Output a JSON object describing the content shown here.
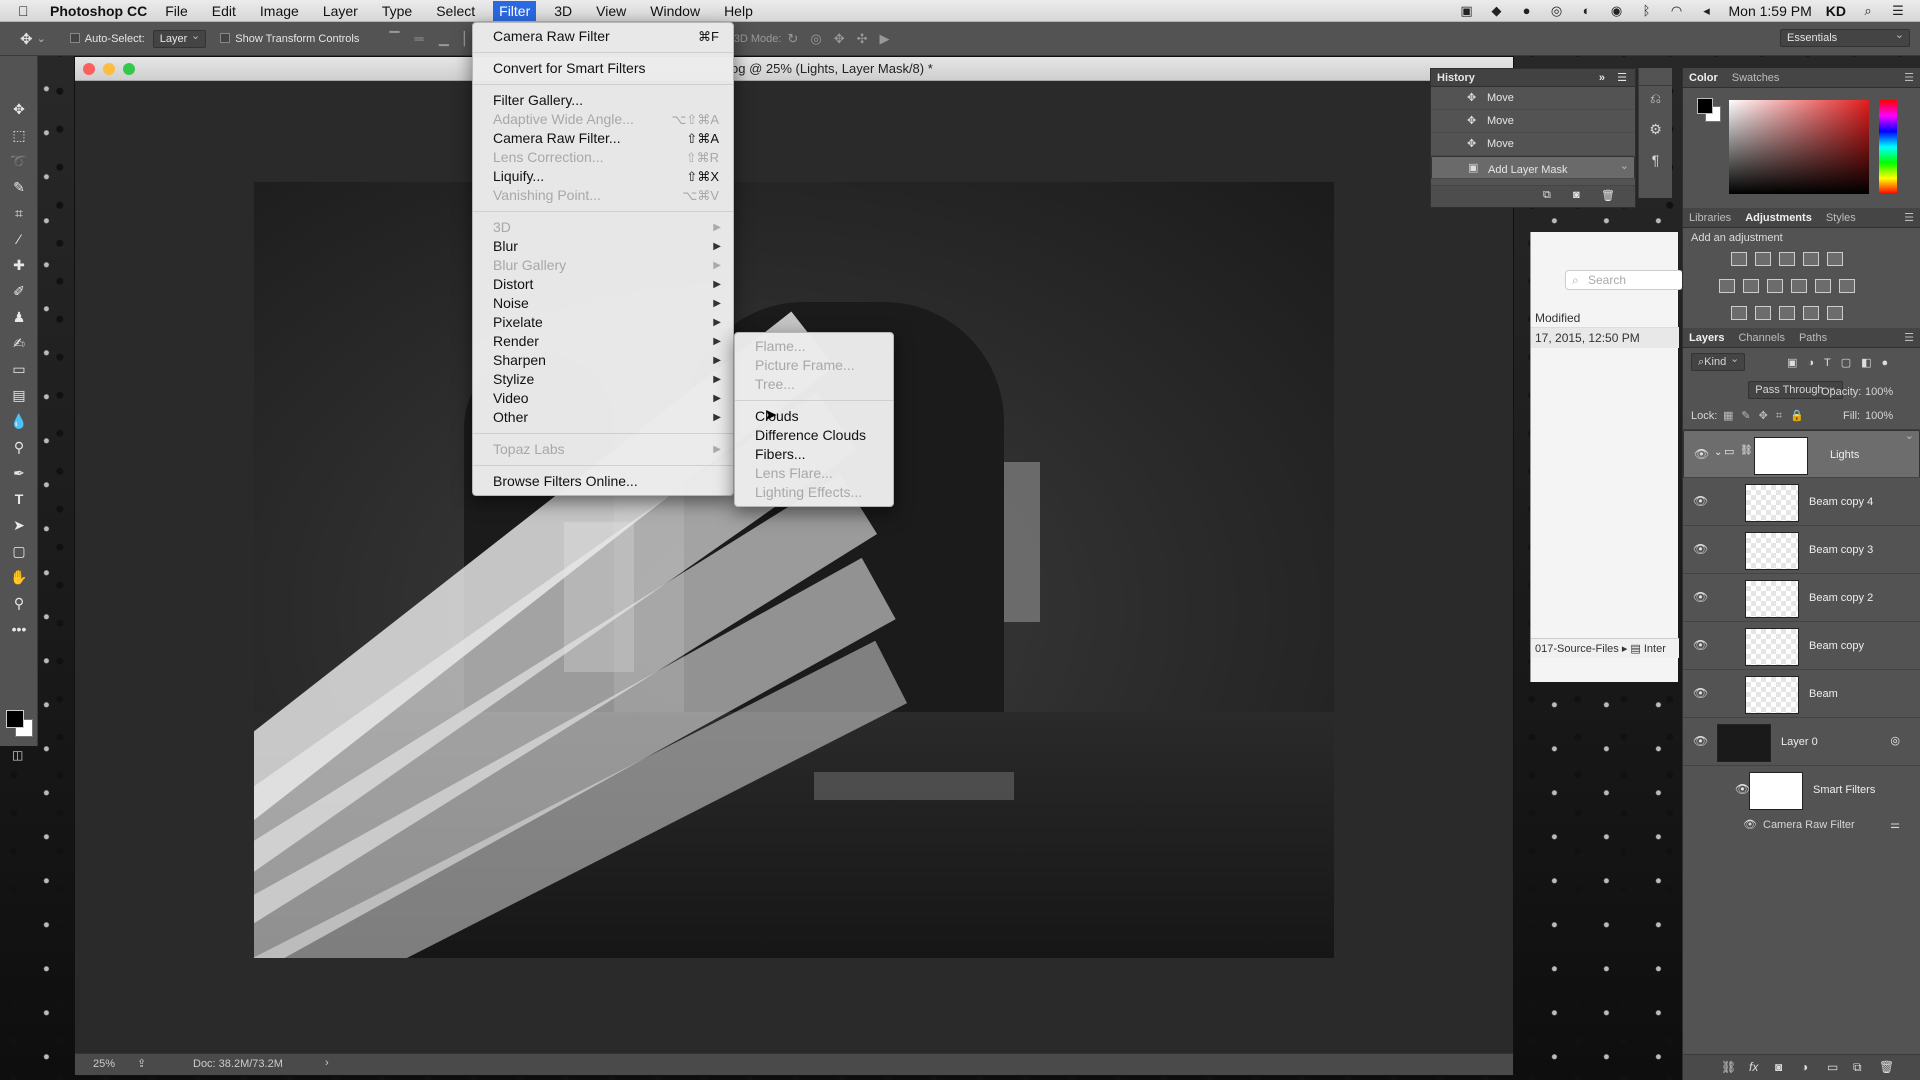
{
  "menubar": {
    "app_name": "Photoshop CC",
    "items": [
      "File",
      "Edit",
      "Image",
      "Layer",
      "Type",
      "Select",
      "Filter",
      "3D",
      "View",
      "Window",
      "Help"
    ],
    "active_item": "Filter",
    "clock": "Mon 1:59 PM",
    "user": "KD"
  },
  "options_bar": {
    "auto_select_label": "Auto-Select:",
    "auto_select_value": "Layer",
    "show_transform_label": "Show Transform Controls",
    "mode_3d_label": "3D Mode:",
    "workspace": "Essentials"
  },
  "document": {
    "title": "og @ 25% (Lights, Layer Mask/8) *",
    "zoom": "25%",
    "doc_size": "Doc: 38.2M/73.2M"
  },
  "filter_menu": {
    "items": [
      {
        "label": "Camera Raw Filter",
        "shortcut": "⌘F",
        "disabled": false,
        "submenu": false
      },
      {
        "sep": true
      },
      {
        "label": "Convert for Smart Filters",
        "shortcut": "",
        "disabled": false,
        "submenu": false
      },
      {
        "sep": true
      },
      {
        "label": "Filter Gallery...",
        "shortcut": "",
        "disabled": false,
        "submenu": false
      },
      {
        "label": "Adaptive Wide Angle...",
        "shortcut": "⌥⇧⌘A",
        "disabled": true,
        "submenu": false
      },
      {
        "label": "Camera Raw Filter...",
        "shortcut": "⇧⌘A",
        "disabled": false,
        "submenu": false
      },
      {
        "label": "Lens Correction...",
        "shortcut": "⇧⌘R",
        "disabled": true,
        "submenu": false
      },
      {
        "label": "Liquify...",
        "shortcut": "⇧⌘X",
        "disabled": false,
        "submenu": false
      },
      {
        "label": "Vanishing Point...",
        "shortcut": "⌥⌘V",
        "disabled": true,
        "submenu": false
      },
      {
        "sep": true
      },
      {
        "label": "3D",
        "shortcut": "",
        "disabled": true,
        "submenu": true
      },
      {
        "label": "Blur",
        "shortcut": "",
        "disabled": false,
        "submenu": true
      },
      {
        "label": "Blur Gallery",
        "shortcut": "",
        "disabled": true,
        "submenu": true
      },
      {
        "label": "Distort",
        "shortcut": "",
        "disabled": false,
        "submenu": true
      },
      {
        "label": "Noise",
        "shortcut": "",
        "disabled": false,
        "submenu": true
      },
      {
        "label": "Pixelate",
        "shortcut": "",
        "disabled": false,
        "submenu": true
      },
      {
        "label": "Render",
        "shortcut": "",
        "disabled": false,
        "submenu": true
      },
      {
        "label": "Sharpen",
        "shortcut": "",
        "disabled": false,
        "submenu": true
      },
      {
        "label": "Stylize",
        "shortcut": "",
        "disabled": false,
        "submenu": true
      },
      {
        "label": "Video",
        "shortcut": "",
        "disabled": false,
        "submenu": true
      },
      {
        "label": "Other",
        "shortcut": "",
        "disabled": false,
        "submenu": true
      },
      {
        "sep": true
      },
      {
        "label": "Topaz Labs",
        "shortcut": "",
        "disabled": true,
        "submenu": true
      },
      {
        "sep": true
      },
      {
        "label": "Browse Filters Online...",
        "shortcut": "",
        "disabled": false,
        "submenu": false
      }
    ]
  },
  "render_submenu": {
    "items": [
      {
        "label": "Flame...",
        "disabled": true
      },
      {
        "label": "Picture Frame...",
        "disabled": true
      },
      {
        "label": "Tree...",
        "disabled": true
      },
      {
        "sep": true
      },
      {
        "label": "Clouds",
        "disabled": false
      },
      {
        "label": "Difference Clouds",
        "disabled": false
      },
      {
        "label": "Fibers...",
        "disabled": false
      },
      {
        "label": "Lens Flare...",
        "disabled": true
      },
      {
        "label": "Lighting Effects...",
        "disabled": true
      }
    ]
  },
  "history_panel": {
    "title": "History",
    "rows": [
      {
        "label": "Move",
        "selected": false
      },
      {
        "label": "Move",
        "selected": false
      },
      {
        "label": "Move",
        "selected": false
      },
      {
        "label": "Add Layer Mask",
        "selected": true
      }
    ]
  },
  "finder_fragment": {
    "search_placeholder": "Search",
    "column_modified": "Modified",
    "date": "17, 2015, 12:50 PM",
    "path_a": "017-Source-Files",
    "path_b": "Inter"
  },
  "color_panel": {
    "tabs": [
      "Color",
      "Swatches"
    ],
    "active": "Color"
  },
  "adjustments_panel": {
    "tabs": [
      "Libraries",
      "Adjustments",
      "Styles"
    ],
    "active": "Adjustments",
    "heading": "Add an adjustment"
  },
  "layers_panel": {
    "tabs": [
      "Layers",
      "Channels",
      "Paths"
    ],
    "active": "Layers",
    "kind_filter": "Kind",
    "blend_mode": "Pass Through",
    "opacity_label": "Opacity:",
    "opacity_value": "100%",
    "lock_label": "Lock:",
    "fill_label": "Fill:",
    "fill_value": "100%",
    "layers": [
      {
        "name": "Lights",
        "type": "group",
        "selected": true
      },
      {
        "name": "Beam copy 4",
        "type": "layer",
        "selected": false
      },
      {
        "name": "Beam copy 3",
        "type": "layer",
        "selected": false
      },
      {
        "name": "Beam copy 2",
        "type": "layer",
        "selected": false
      },
      {
        "name": "Beam copy",
        "type": "layer",
        "selected": false
      },
      {
        "name": "Beam",
        "type": "layer",
        "selected": false
      },
      {
        "name": "Layer 0",
        "type": "smart",
        "selected": false
      }
    ],
    "smart_filters_label": "Smart Filters",
    "camera_raw_label": "Camera Raw Filter"
  }
}
